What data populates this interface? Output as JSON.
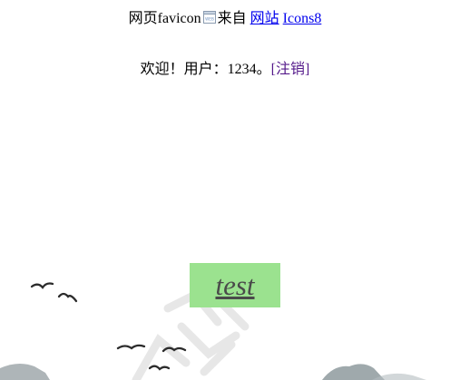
{
  "header": {
    "prefix": "网页favicon",
    "favicon_icon": "web-favicon-icon",
    "from_text": "来自",
    "link_website": "网站",
    "link_icons8": "Icons8"
  },
  "welcome": {
    "text": "欢迎！用户：1234。",
    "logout_label": "[注销]"
  },
  "button": {
    "label": "test",
    "color": "#9be28f"
  },
  "background": {
    "style": "ink-wash landscape with birds and calligraphy watermark"
  }
}
